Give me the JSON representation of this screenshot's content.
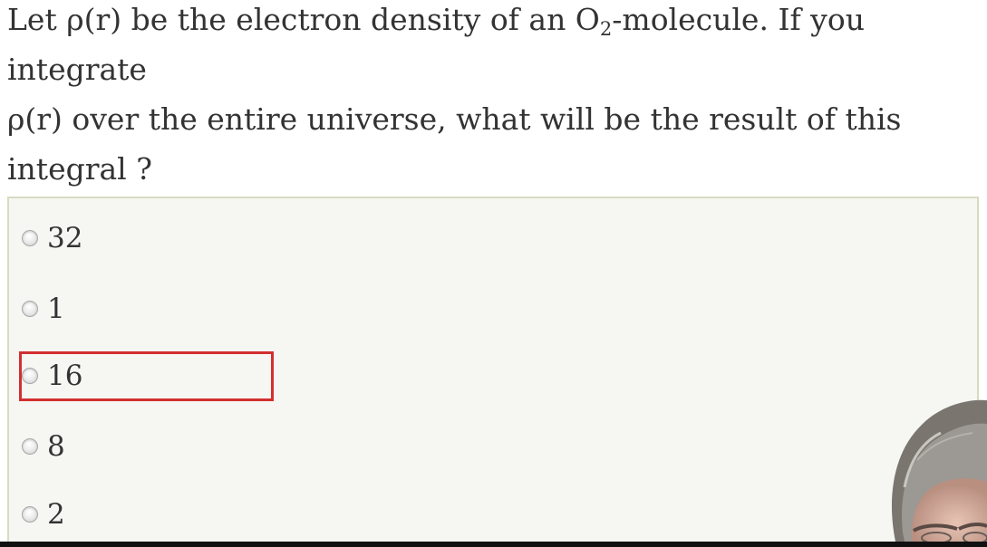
{
  "question": {
    "line1_part1": "Let ρ(r) be the electron density of an O",
    "line1_sub": "2",
    "line1_part2": "-molecule. If you integrate",
    "line2": "ρ(r) over the entire universe, what will be the result of this",
    "line3": "integral ?"
  },
  "options": [
    {
      "label": "32",
      "selected": false
    },
    {
      "label": "1",
      "selected": false
    },
    {
      "label": "16",
      "selected": false,
      "highlighted": true
    },
    {
      "label": "8",
      "selected": false
    },
    {
      "label": "2",
      "selected": false
    }
  ],
  "colors": {
    "text": "#333333",
    "options_background": "#f6f6f2",
    "options_border": "#d6dcc0",
    "highlight_border": "#d32f2f"
  }
}
